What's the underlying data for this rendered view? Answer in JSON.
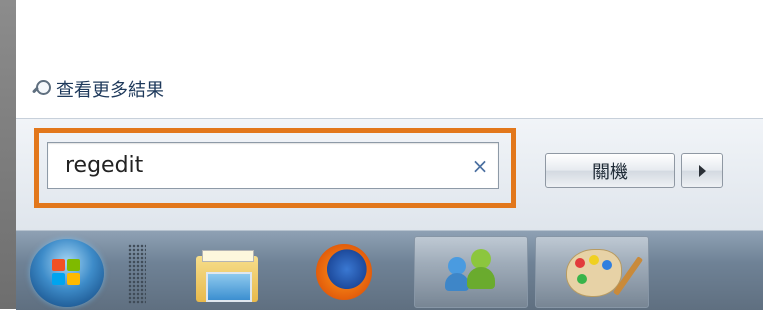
{
  "start_menu": {
    "see_more_results": "查看更多結果",
    "search": {
      "value": "regedit",
      "clear_glyph": "×"
    },
    "shutdown_label": "關機"
  },
  "taskbar": {
    "pinned": [
      {
        "icon": "windows-explorer-icon"
      },
      {
        "icon": "firefox-icon"
      },
      {
        "icon": "windows-live-messenger-icon"
      },
      {
        "icon": "paint-icon"
      }
    ]
  },
  "colors": {
    "highlight": "#e2771b",
    "taskbar": "#6f8296"
  }
}
